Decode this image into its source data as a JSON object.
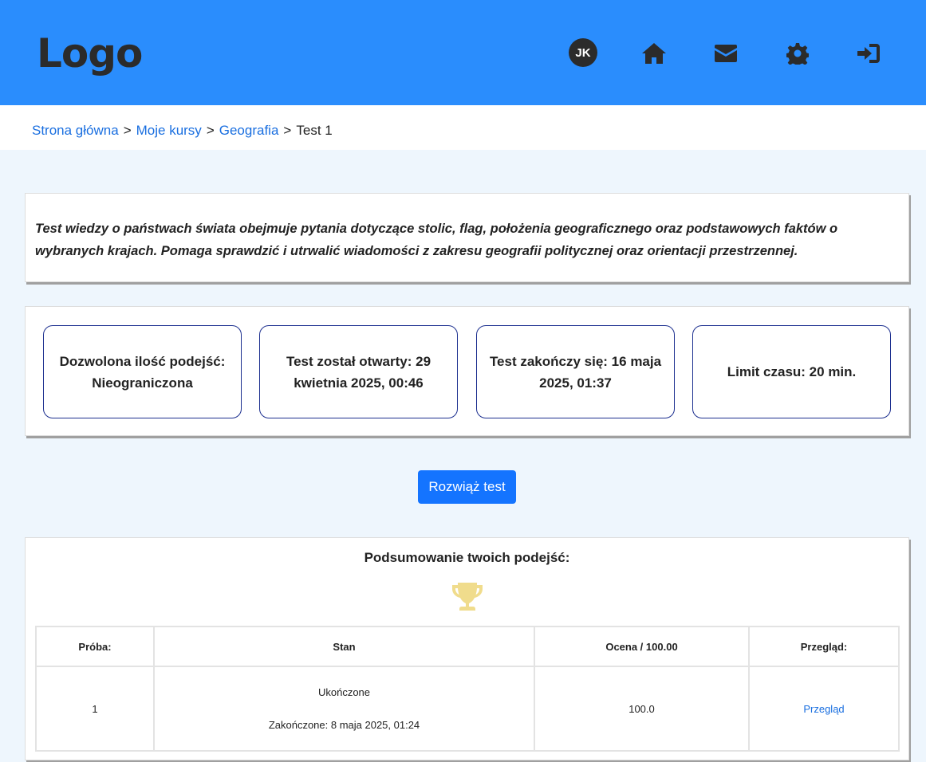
{
  "header": {
    "logo": "Logo",
    "avatar_initials": "JK",
    "icons": [
      "home-icon",
      "mail-icon",
      "gear-icon",
      "sign-in-icon"
    ],
    "colors": {
      "bar": "#2a8dfd",
      "icon": "#2b2b2b"
    }
  },
  "breadcrumb": {
    "items": [
      "Strona główna",
      "Moje kursy",
      "Geografia"
    ],
    "separator": ">",
    "current": "Test 1"
  },
  "description": "Test wiedzy o państwach świata obejmuje pytania dotyczące stolic, flag, położenia geograficznego oraz podstawowych faktów o wybranych krajach. Pomaga sprawdzić i utrwalić wiadomości z zakresu geografii politycznej oraz orientacji przestrzennej.",
  "info": [
    "Dozwolona ilość podejść: Nieograniczona",
    "Test został otwarty: 29 kwietnia 2025, 00:46",
    "Test zakończy się: 16 maja 2025, 01:37",
    "Limit czasu: 20 min."
  ],
  "solve_button": "Rozwiąż test",
  "summary": {
    "title": "Podsumowanie twoich podejść:",
    "icon": "trophy-icon",
    "trophy_color": "#f0dc8c",
    "columns": [
      "Próba:",
      "Stan",
      "Ocena / 100.00",
      "Przegląd:"
    ],
    "rows": [
      {
        "attempt": "1",
        "status": "Ukończone",
        "finished": "Zakończone: 8 maja 2025, 01:24",
        "grade": "100.0",
        "review": "Przegląd"
      }
    ]
  }
}
